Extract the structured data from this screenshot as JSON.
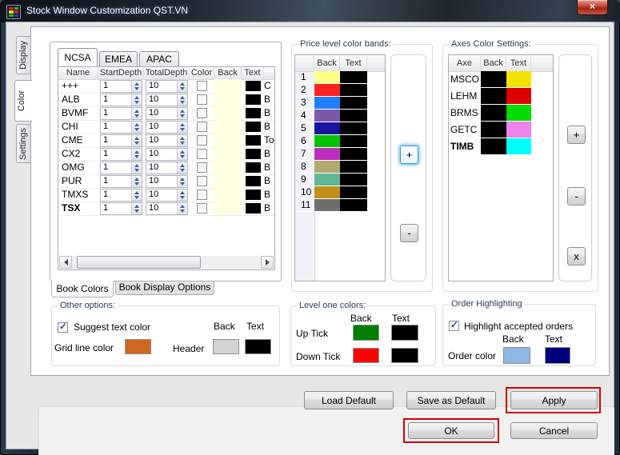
{
  "window": {
    "title": "Stock Window Customization QST.VN"
  },
  "icons": {
    "close": "×",
    "check": "✓"
  },
  "side_tabs": [
    {
      "label": "Display",
      "selected": false
    },
    {
      "label": "Color",
      "selected": true
    },
    {
      "label": "Settings",
      "selected": false
    }
  ],
  "region_tabs": [
    {
      "label": "NCSA",
      "selected": true
    },
    {
      "label": "EMEA",
      "selected": false
    },
    {
      "label": "APAC",
      "selected": false
    }
  ],
  "book_table": {
    "headers": [
      "Name",
      "StartDepth",
      "TotalDepth",
      "Color",
      "Back",
      "Text"
    ],
    "back_color": "#FFFFE1",
    "text_color": "#000000",
    "rows": [
      {
        "name": "+++",
        "start": "1",
        "total": "10",
        "checked": false,
        "extra": "C"
      },
      {
        "name": "ALB",
        "start": "1",
        "total": "10",
        "checked": false,
        "extra": "B"
      },
      {
        "name": "BVMF",
        "start": "1",
        "total": "10",
        "checked": false,
        "extra": "B"
      },
      {
        "name": "CHI",
        "start": "1",
        "total": "10",
        "checked": false,
        "extra": "B"
      },
      {
        "name": "CME",
        "start": "1",
        "total": "10",
        "checked": false,
        "extra": "To"
      },
      {
        "name": "CX2",
        "start": "1",
        "total": "10",
        "checked": false,
        "extra": "B"
      },
      {
        "name": "OMG",
        "start": "1",
        "total": "10",
        "checked": false,
        "extra": "B"
      },
      {
        "name": "PUR",
        "start": "1",
        "total": "10",
        "checked": false,
        "extra": "B"
      },
      {
        "name": "TMXS",
        "start": "1",
        "total": "10",
        "checked": false,
        "extra": "B"
      },
      {
        "name": "TSX",
        "start": "1",
        "total": "10",
        "checked": false,
        "extra": "B"
      }
    ]
  },
  "book_tabs": [
    {
      "label": "Book Colors",
      "selected": true
    },
    {
      "label": "Book Display Options",
      "selected": false
    }
  ],
  "price_bands": {
    "title": "Price level color bands:",
    "back_header": "Back",
    "text_header": "Text",
    "add_label": "+",
    "remove_label": "-",
    "rows": [
      {
        "num": "1",
        "back": "#FFFF84",
        "text": "#000000"
      },
      {
        "num": "2",
        "back": "#FF2020",
        "text": "#000000"
      },
      {
        "num": "3",
        "back": "#1E7EFF",
        "text": "#000000"
      },
      {
        "num": "4",
        "back": "#7B58A8",
        "text": "#000000"
      },
      {
        "num": "5",
        "back": "#1A13A0",
        "text": "#000000"
      },
      {
        "num": "6",
        "back": "#00C400",
        "text": "#000000"
      },
      {
        "num": "7",
        "back": "#BC2EBC",
        "text": "#000000"
      },
      {
        "num": "8",
        "back": "#B2AA70",
        "text": "#000000"
      },
      {
        "num": "9",
        "back": "#62B794",
        "text": "#000000"
      },
      {
        "num": "10",
        "back": "#C28F18",
        "text": "#000000"
      },
      {
        "num": "11",
        "back": "#6F6F6F",
        "text": "#000000"
      }
    ]
  },
  "axes_settings": {
    "title": "Axes Color Settings:",
    "axe_header": "Axe",
    "back_header": "Back",
    "text_header": "Text",
    "add_label": "+",
    "remove_label": "-",
    "delete_label": "x",
    "rows": [
      {
        "axe": "MSCO",
        "back": "#000000",
        "text": "#F2E400"
      },
      {
        "axe": "LEHM",
        "back": "#000000",
        "text": "#DE0000"
      },
      {
        "axe": "BRMS",
        "back": "#000000",
        "text": "#00DC00"
      },
      {
        "axe": "GETC",
        "back": "#000000",
        "text": "#EE82EE"
      },
      {
        "axe": "TIMB",
        "back": "#000000",
        "text": "#00FFFF"
      }
    ]
  },
  "other_options": {
    "title": "Other options:",
    "suggest_label": "Suggest  text color",
    "suggest_checked": true,
    "back_header": "Back",
    "text_header": "Text",
    "grid_line_label": "Grid line color",
    "grid_line_color": "#CE6820",
    "header_label": "Header",
    "header_back": "#D4D4D4",
    "header_text": "#000000"
  },
  "level_one": {
    "title": "Level one colors:",
    "back_header": "Back",
    "text_header": "Text",
    "rows": [
      {
        "label": "Up Tick",
        "back": "#007E00",
        "text": "#000000"
      },
      {
        "label": "Down Tick",
        "back": "#FE0000",
        "text": "#000000"
      }
    ]
  },
  "order_highlighting": {
    "title": "Order Highlighting",
    "checkbox_label": "Highlight accepted orders",
    "checked": true,
    "back_header": "Back",
    "text_header": "Text",
    "label": "Order color",
    "back": "#8FB8E8",
    "text": "#00007E"
  },
  "action_buttons": {
    "load_default": "Load Default",
    "save_as_default": "Save as Default",
    "apply": "Apply",
    "ok": "OK",
    "cancel": "Cancel"
  },
  "annotation_color": "#D40000"
}
